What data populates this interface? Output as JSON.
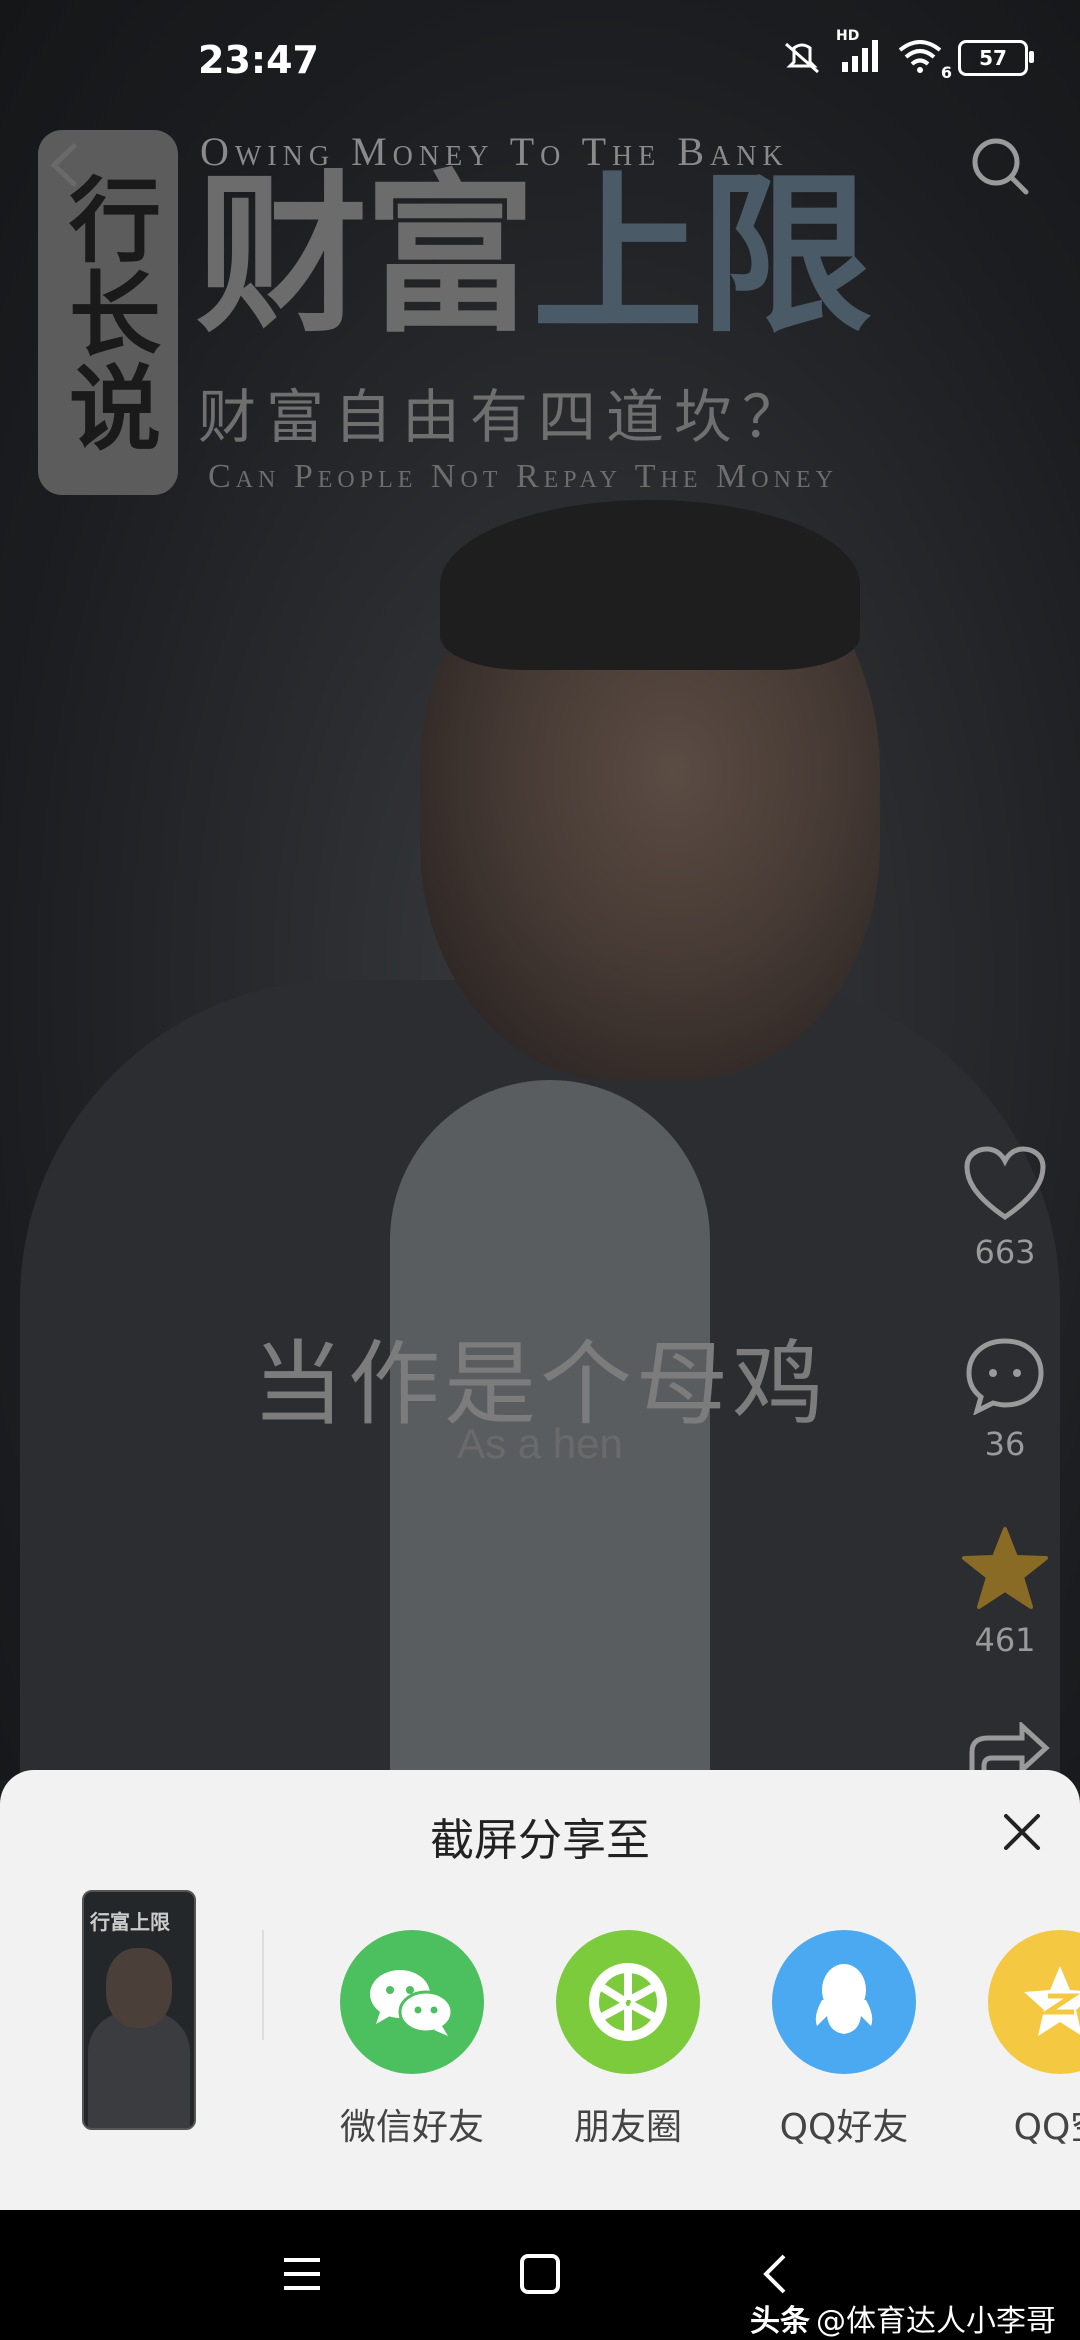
{
  "status_bar": {
    "time": "23:47",
    "network": "HD",
    "wifi_badge": "6",
    "battery": "57"
  },
  "video": {
    "badge": "行长说",
    "title_en_top": "Owing Money To The Bank",
    "title_main_part1": "财富",
    "title_main_part2": "上限",
    "title_sub": "财富自由有四道坎？",
    "title_en_bottom": "Can People Not Repay The Money",
    "subtitle_cn": "当作是个母鸡",
    "subtitle_en": "As a hen"
  },
  "actions": {
    "likes": "663",
    "comments": "36",
    "favorites": "461"
  },
  "share_sheet": {
    "title": "截屏分享至",
    "thumbnail_title": "行富上限",
    "items": [
      {
        "label": "微信好友",
        "icon": "wechat-icon",
        "color": "#4cbf5f"
      },
      {
        "label": "朋友圈",
        "icon": "moments-icon",
        "color": "#7ccb3c"
      },
      {
        "label": "QQ好友",
        "icon": "qq-icon",
        "color": "#4aa9f0"
      },
      {
        "label": "QQ空",
        "icon": "qzone-icon",
        "color": "#f5c842"
      }
    ]
  },
  "watermark": {
    "brand": "头条",
    "handle": "@体育达人小李哥"
  }
}
